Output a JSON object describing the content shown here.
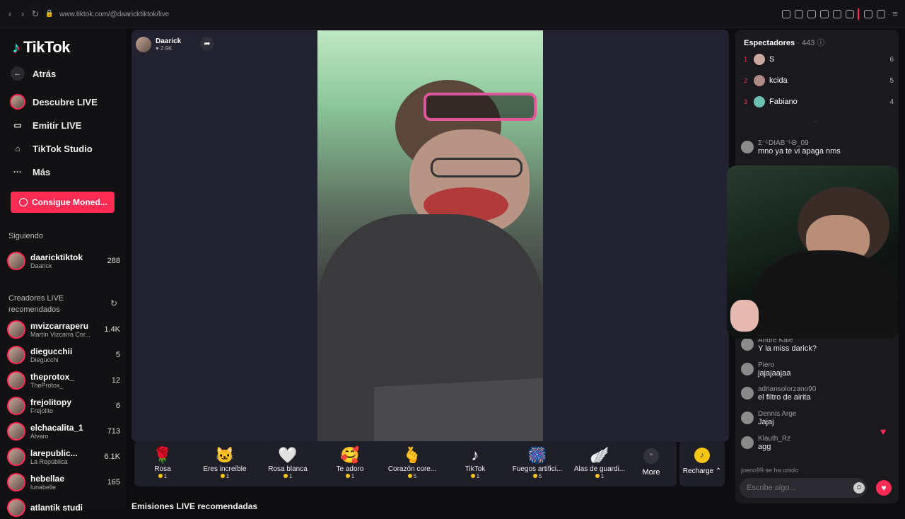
{
  "browser": {
    "url": "www.tiktok.com/@daaricktiktok/live"
  },
  "brand": {
    "name": "TikTok"
  },
  "nav": {
    "back": "Atrás",
    "discover": "Descubre LIVE",
    "broadcast": "Emitir LIVE",
    "studio": "TikTok Studio",
    "more": "Más",
    "coins_button": "Consigue Moned..."
  },
  "following": {
    "title": "Siguiendo",
    "name": "daaricktiktok",
    "sub": "Daarick",
    "count": "288"
  },
  "recommended": {
    "title_line1": "Creadores LIVE",
    "title_line2": "recomendados",
    "creators": [
      {
        "name": "mvizcarraperu",
        "sub": "Martín Vizcarra Cor...",
        "count": "1.4K"
      },
      {
        "name": "diegucchii",
        "sub": "Diegucchi",
        "count": "5"
      },
      {
        "name": "theprotox_",
        "sub": "TheProtox_",
        "count": "12"
      },
      {
        "name": "frejolitopy",
        "sub": "Frejolito",
        "count": "6"
      },
      {
        "name": "elchacalita_1",
        "sub": "Alvaro",
        "count": "713"
      },
      {
        "name": "larepublic...",
        "sub": "La República",
        "count": "6.1K"
      },
      {
        "name": "hebellae",
        "sub": "lunabelle",
        "count": "165"
      },
      {
        "name": "atlantik studi",
        "sub": "",
        "count": ""
      }
    ]
  },
  "host": {
    "name": "Daarick",
    "likes": "2.9K"
  },
  "gifts": [
    {
      "label": "Rosa",
      "price": "1",
      "icon": "🌹"
    },
    {
      "label": "Eres increíble",
      "price": "1",
      "icon": "🐱"
    },
    {
      "label": "Rosa blanca",
      "price": "1",
      "icon": "🤍"
    },
    {
      "label": "Te adoro",
      "price": "1",
      "icon": "🥰"
    },
    {
      "label": "Corazón core...",
      "price": "5",
      "icon": "🫰"
    },
    {
      "label": "TikTok",
      "price": "1",
      "icon": "♪"
    },
    {
      "label": "Fuegos artifici...",
      "price": "5",
      "icon": "🎆"
    },
    {
      "label": "Alas de guardi...",
      "price": "1",
      "icon": "🪽"
    }
  ],
  "gift_more": "More",
  "recharge": "Recharge",
  "recommended_streams": "Emisiones LIVE recomendadas",
  "viewers": {
    "title": "Espectadores",
    "count": "443",
    "list": [
      {
        "rank": "1",
        "name": "S",
        "score": "6"
      },
      {
        "rank": "2",
        "name": "kcida",
        "score": "5"
      },
      {
        "rank": "3",
        "name": "Fabiano",
        "score": "4"
      }
    ]
  },
  "chat": {
    "messages": [
      {
        "user": "Σ⁻ᴸDIAB⁻ᴸΘ_09",
        "text": "mno ya te vi apaga nms"
      },
      {
        "user": "Andre Kale",
        "text": "Y la miss darick?"
      },
      {
        "user": "Piero",
        "text": "jajajaajaa"
      },
      {
        "user": "adriansolorzano90",
        "text": "el filtro de airita"
      },
      {
        "user": "Dennis Arge",
        "text": "Jajaj"
      },
      {
        "user": "Klauth_Rz",
        "text": "agg"
      }
    ],
    "joined": "joeno99 se ha unido",
    "placeholder": "Escribe algo..."
  },
  "colors": {
    "accent": "#fe2c55",
    "coin": "#f5c518"
  }
}
